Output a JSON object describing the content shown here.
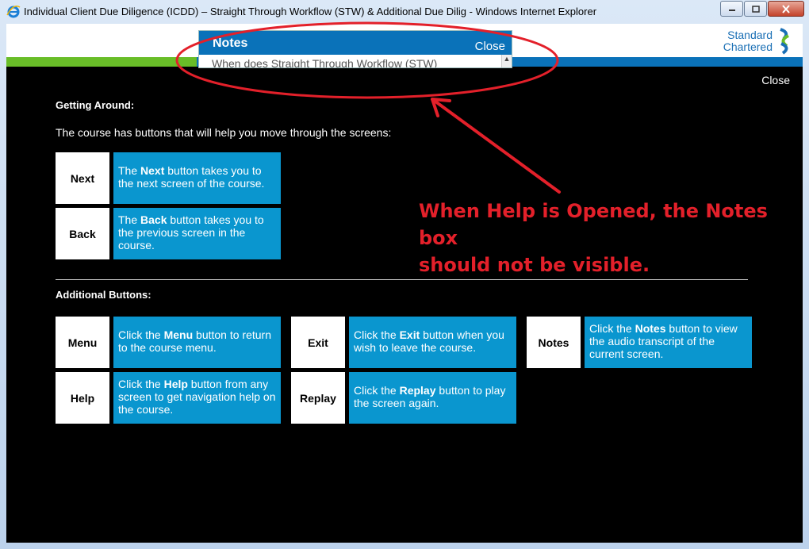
{
  "window": {
    "title": "Individual Client Due Diligence (ICDD) – Straight Through Workflow (STW) & Additional Due Dilig - Windows Internet Explorer"
  },
  "logo": {
    "line1": "Standard",
    "line2": "Chartered"
  },
  "notes": {
    "title": "Notes",
    "close": "Close",
    "body": "When does Straight Through Workflow (STW)"
  },
  "help": {
    "close": "Close",
    "getting_around": "Getting Around:",
    "intro": "The course has buttons that will help you move through the screens:",
    "additional": "Additional Buttons:",
    "buttons": [
      {
        "label": "Next",
        "pre": "The ",
        "bold": "Next",
        "post": " button takes you to the next screen of the course."
      },
      {
        "label": "Back",
        "pre": "The ",
        "bold": "Back",
        "post": " button takes you to the previous screen in the course."
      },
      {
        "label": "Menu",
        "pre": "Click the ",
        "bold": "Menu",
        "post": " button to return to the course menu."
      },
      {
        "label": "Help",
        "pre": "Click the ",
        "bold": "Help",
        "post": " button from any screen to get navigation help on the course."
      },
      {
        "label": "Exit",
        "pre": "Click the ",
        "bold": "Exit",
        "post": " button when you wish to leave the course."
      },
      {
        "label": "Replay",
        "pre": "Click the ",
        "bold": "Replay",
        "post": " button to play the screen again."
      },
      {
        "label": "Notes",
        "pre": "Click the ",
        "bold": "Notes",
        "post": " button to view the audio transcript of the current screen."
      }
    ]
  },
  "annotation": {
    "line1": "When Help is Opened, the Notes box",
    "line2": "should not be visible."
  },
  "colors": {
    "accent_blue": "#0a96cf",
    "header_blue": "#0a72b9",
    "green": "#69bd28",
    "annotation_red": "#e3202a"
  }
}
